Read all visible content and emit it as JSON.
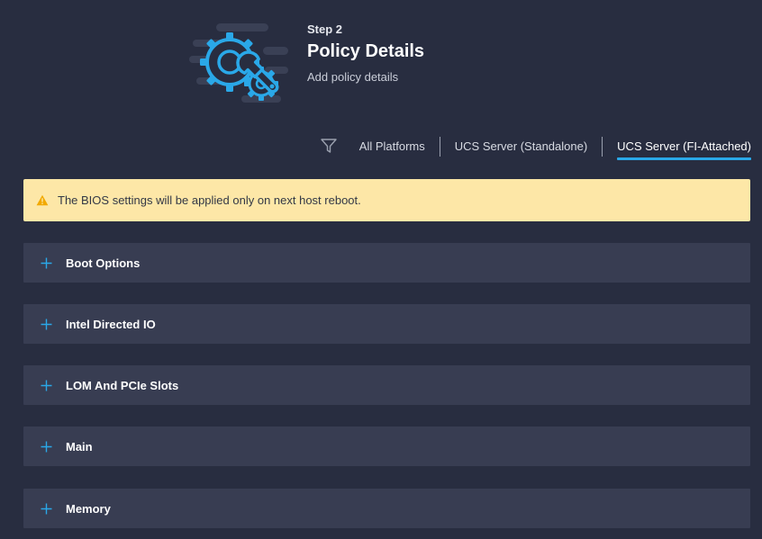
{
  "header": {
    "step": "Step 2",
    "title": "Policy Details",
    "subtitle": "Add policy details",
    "illustration_icon": "gear-wrench-icon"
  },
  "filter": {
    "icon": "filter-icon",
    "tabs": [
      {
        "label": "All Platforms",
        "active": false
      },
      {
        "label": "UCS Server (Standalone)",
        "active": false
      },
      {
        "label": "UCS Server (FI-Attached)",
        "active": true
      }
    ]
  },
  "warning": {
    "icon": "warning-icon",
    "text": "The BIOS settings will be applied only on next host reboot."
  },
  "sections": [
    {
      "label": "Boot Options"
    },
    {
      "label": "Intel Directed IO"
    },
    {
      "label": "LOM And PCIe Slots"
    },
    {
      "label": "Main"
    },
    {
      "label": "Memory"
    }
  ],
  "colors": {
    "background": "#282d40",
    "section_background": "#383d52",
    "accent": "#2aa8e8",
    "warning_background": "#fde7a7",
    "warning_icon": "#f2a900"
  }
}
